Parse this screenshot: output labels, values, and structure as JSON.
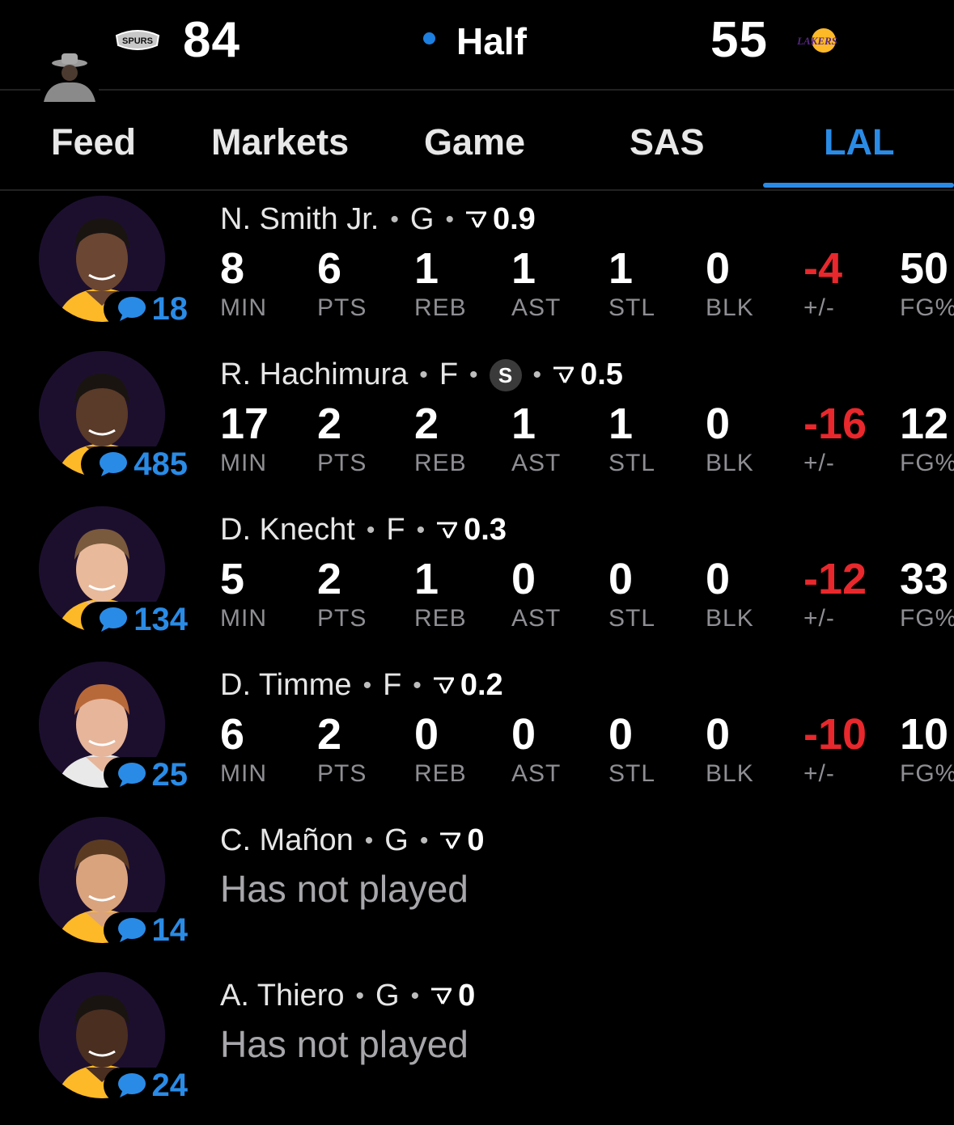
{
  "scoreboard": {
    "home_score": "84",
    "status": "Half",
    "away_score": "55",
    "home_team_logo": "SPURS",
    "away_team_logo": "LAKERS",
    "status_color": "#1d7fe0"
  },
  "tabs": [
    {
      "label": "Feed"
    },
    {
      "label": "Markets"
    },
    {
      "label": "Game"
    },
    {
      "label": "SAS"
    },
    {
      "label": "LAL",
      "active": true
    }
  ],
  "accent": "#2a8be6",
  "negative_color": "#e8282c",
  "players": [
    {
      "name": "N. Smith Jr.",
      "pos": "G",
      "starter": false,
      "rating": "0.9",
      "chats": "18",
      "stats": [
        {
          "value": "8",
          "label": "MIN"
        },
        {
          "value": "6",
          "label": "PTS"
        },
        {
          "value": "1",
          "label": "REB"
        },
        {
          "value": "1",
          "label": "AST"
        },
        {
          "value": "1",
          "label": "STL"
        },
        {
          "value": "0",
          "label": "BLK"
        },
        {
          "value": "-4",
          "label": "+/-"
        },
        {
          "value": "50",
          "label": "FG%"
        }
      ]
    },
    {
      "name": "R. Hachimura",
      "pos": "F",
      "starter": true,
      "starter_label": "S",
      "rating": "0.5",
      "chats": "485",
      "stats": [
        {
          "value": "17",
          "label": "MIN"
        },
        {
          "value": "2",
          "label": "PTS"
        },
        {
          "value": "2",
          "label": "REB"
        },
        {
          "value": "1",
          "label": "AST"
        },
        {
          "value": "1",
          "label": "STL"
        },
        {
          "value": "0",
          "label": "BLK"
        },
        {
          "value": "-16",
          "label": "+/-"
        },
        {
          "value": "12",
          "label": "FG%"
        }
      ]
    },
    {
      "name": "D. Knecht",
      "pos": "F",
      "starter": false,
      "rating": "0.3",
      "chats": "134",
      "stats": [
        {
          "value": "5",
          "label": "MIN"
        },
        {
          "value": "2",
          "label": "PTS"
        },
        {
          "value": "1",
          "label": "REB"
        },
        {
          "value": "0",
          "label": "AST"
        },
        {
          "value": "0",
          "label": "STL"
        },
        {
          "value": "0",
          "label": "BLK"
        },
        {
          "value": "-12",
          "label": "+/-"
        },
        {
          "value": "33",
          "label": "FG%"
        }
      ]
    },
    {
      "name": "D. Timme",
      "pos": "F",
      "starter": false,
      "rating": "0.2",
      "chats": "25",
      "stats": [
        {
          "value": "6",
          "label": "MIN"
        },
        {
          "value": "2",
          "label": "PTS"
        },
        {
          "value": "0",
          "label": "REB"
        },
        {
          "value": "0",
          "label": "AST"
        },
        {
          "value": "0",
          "label": "STL"
        },
        {
          "value": "0",
          "label": "BLK"
        },
        {
          "value": "-10",
          "label": "+/-"
        },
        {
          "value": "10",
          "label": "FG%"
        }
      ]
    },
    {
      "name": "C. Mañon",
      "pos": "G",
      "starter": false,
      "rating": "0",
      "chats": "14",
      "status": "Has not played"
    },
    {
      "name": "A. Thiero",
      "pos": "G",
      "starter": false,
      "rating": "0",
      "chats": "24",
      "status": "Has not played"
    }
  ]
}
